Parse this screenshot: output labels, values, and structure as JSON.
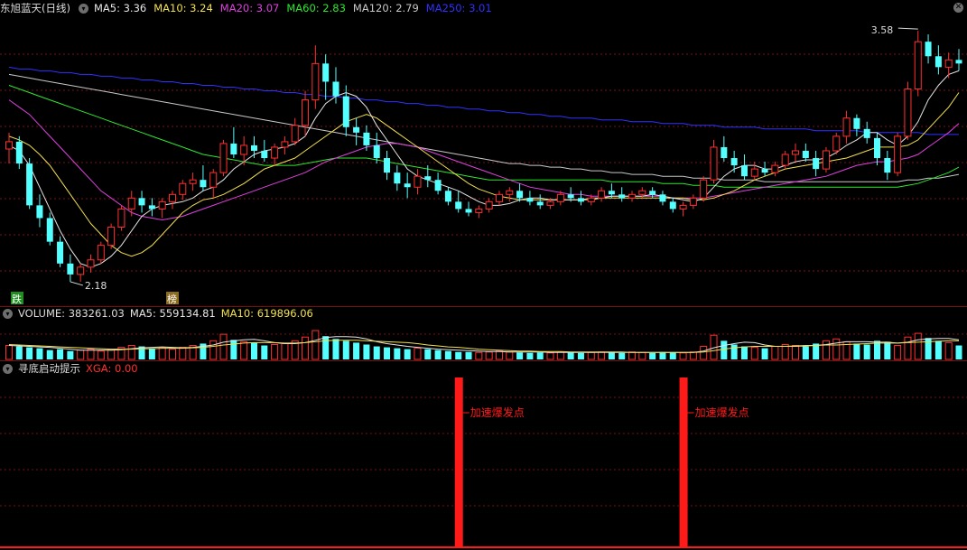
{
  "main_panel": {
    "title": "东旭蓝天",
    "period": "(日线)",
    "ma_values": [
      {
        "label": "MA5:",
        "value": "3.36",
        "color": "#e6e6e6"
      },
      {
        "label": "MA10:",
        "value": "3.24",
        "color": "#f2e14b"
      },
      {
        "label": "MA20:",
        "value": "3.07",
        "color": "#e040e0"
      },
      {
        "label": "MA60:",
        "value": "2.83",
        "color": "#2ee82e"
      },
      {
        "label": "MA120:",
        "value": "2.79",
        "color": "#c8c8c8"
      },
      {
        "label": "MA250:",
        "value": "3.01",
        "color": "#3030ff"
      }
    ],
    "low_marker": "2.18",
    "high_marker": "3.58",
    "tag_die": "跌",
    "tag_bang": "榜"
  },
  "volume_panel": {
    "title": "VOLUME:",
    "value": "383261.03",
    "ma5_label": "MA5:",
    "ma5_value": "559134.81",
    "ma10_label": "MA10:",
    "ma10_value": "619896.06"
  },
  "indicator_panel": {
    "title": "寻底启动提示",
    "xga_label": "XGA:",
    "xga_value": "0.00",
    "signal_label": "加速爆发点"
  },
  "colors": {
    "up": "#ff3030",
    "down": "#54ffff",
    "grid": "#7a1010",
    "signal": "#ff1a1a"
  },
  "chart_data": {
    "type": "candlestick",
    "price_range": [
      2.15,
      3.65
    ],
    "ohlc": [
      [
        2.93,
        3.02,
        2.85,
        2.97
      ],
      [
        2.97,
        3.0,
        2.82,
        2.85
      ],
      [
        2.85,
        2.88,
        2.6,
        2.62
      ],
      [
        2.62,
        2.68,
        2.5,
        2.55
      ],
      [
        2.55,
        2.58,
        2.4,
        2.42
      ],
      [
        2.42,
        2.45,
        2.28,
        2.3
      ],
      [
        2.3,
        2.35,
        2.2,
        2.24
      ],
      [
        2.24,
        2.3,
        2.2,
        2.28
      ],
      [
        2.28,
        2.35,
        2.25,
        2.32
      ],
      [
        2.32,
        2.42,
        2.3,
        2.4
      ],
      [
        2.4,
        2.52,
        2.38,
        2.5
      ],
      [
        2.5,
        2.62,
        2.48,
        2.6
      ],
      [
        2.6,
        2.7,
        2.56,
        2.66
      ],
      [
        2.66,
        2.7,
        2.58,
        2.62
      ],
      [
        2.62,
        2.66,
        2.56,
        2.6
      ],
      [
        2.6,
        2.66,
        2.55,
        2.64
      ],
      [
        2.64,
        2.7,
        2.6,
        2.68
      ],
      [
        2.68,
        2.76,
        2.65,
        2.74
      ],
      [
        2.74,
        2.8,
        2.7,
        2.76
      ],
      [
        2.76,
        2.84,
        2.7,
        2.72
      ],
      [
        2.72,
        2.82,
        2.66,
        2.8
      ],
      [
        2.8,
        2.98,
        2.78,
        2.96
      ],
      [
        2.96,
        3.05,
        2.88,
        2.9
      ],
      [
        2.9,
        3.0,
        2.84,
        2.95
      ],
      [
        2.95,
        3.0,
        2.88,
        2.92
      ],
      [
        2.92,
        2.98,
        2.86,
        2.88
      ],
      [
        2.88,
        2.96,
        2.84,
        2.94
      ],
      [
        2.94,
        3.0,
        2.9,
        2.97
      ],
      [
        2.97,
        3.1,
        2.95,
        3.06
      ],
      [
        3.06,
        3.25,
        3.0,
        3.2
      ],
      [
        3.2,
        3.5,
        3.15,
        3.4
      ],
      [
        3.4,
        3.45,
        3.2,
        3.3
      ],
      [
        3.3,
        3.38,
        3.18,
        3.22
      ],
      [
        3.22,
        3.28,
        3.0,
        3.05
      ],
      [
        3.05,
        3.1,
        2.95,
        3.02
      ],
      [
        3.02,
        3.06,
        2.92,
        2.95
      ],
      [
        2.95,
        3.02,
        2.85,
        2.88
      ],
      [
        2.88,
        2.92,
        2.76,
        2.8
      ],
      [
        2.8,
        2.84,
        2.7,
        2.74
      ],
      [
        2.74,
        2.8,
        2.66,
        2.72
      ],
      [
        2.72,
        2.82,
        2.68,
        2.78
      ],
      [
        2.78,
        2.84,
        2.72,
        2.76
      ],
      [
        2.76,
        2.8,
        2.68,
        2.7
      ],
      [
        2.7,
        2.72,
        2.62,
        2.64
      ],
      [
        2.64,
        2.7,
        2.58,
        2.6
      ],
      [
        2.6,
        2.64,
        2.56,
        2.58
      ],
      [
        2.58,
        2.62,
        2.55,
        2.6
      ],
      [
        2.6,
        2.66,
        2.58,
        2.64
      ],
      [
        2.64,
        2.7,
        2.62,
        2.68
      ],
      [
        2.68,
        2.72,
        2.64,
        2.7
      ],
      [
        2.7,
        2.74,
        2.64,
        2.66
      ],
      [
        2.66,
        2.7,
        2.62,
        2.64
      ],
      [
        2.64,
        2.68,
        2.6,
        2.62
      ],
      [
        2.62,
        2.66,
        2.6,
        2.64
      ],
      [
        2.64,
        2.7,
        2.62,
        2.68
      ],
      [
        2.68,
        2.72,
        2.64,
        2.66
      ],
      [
        2.66,
        2.7,
        2.62,
        2.64
      ],
      [
        2.64,
        2.68,
        2.62,
        2.66
      ],
      [
        2.66,
        2.72,
        2.64,
        2.7
      ],
      [
        2.7,
        2.74,
        2.66,
        2.68
      ],
      [
        2.68,
        2.72,
        2.64,
        2.66
      ],
      [
        2.66,
        2.7,
        2.64,
        2.68
      ],
      [
        2.68,
        2.72,
        2.66,
        2.7
      ],
      [
        2.7,
        2.72,
        2.66,
        2.68
      ],
      [
        2.68,
        2.7,
        2.62,
        2.64
      ],
      [
        2.64,
        2.66,
        2.58,
        2.6
      ],
      [
        2.6,
        2.64,
        2.56,
        2.62
      ],
      [
        2.62,
        2.68,
        2.6,
        2.66
      ],
      [
        2.66,
        2.78,
        2.64,
        2.76
      ],
      [
        2.76,
        2.98,
        2.74,
        2.94
      ],
      [
        2.94,
        3.0,
        2.86,
        2.88
      ],
      [
        2.88,
        2.92,
        2.8,
        2.84
      ],
      [
        2.84,
        2.9,
        2.76,
        2.78
      ],
      [
        2.78,
        2.86,
        2.76,
        2.82
      ],
      [
        2.82,
        2.86,
        2.78,
        2.8
      ],
      [
        2.8,
        2.86,
        2.78,
        2.84
      ],
      [
        2.84,
        2.92,
        2.82,
        2.9
      ],
      [
        2.9,
        2.96,
        2.86,
        2.92
      ],
      [
        2.92,
        2.96,
        2.86,
        2.88
      ],
      [
        2.88,
        2.92,
        2.78,
        2.82
      ],
      [
        2.82,
        2.94,
        2.8,
        2.92
      ],
      [
        2.92,
        3.02,
        2.9,
        3.0
      ],
      [
        3.0,
        3.14,
        2.96,
        3.1
      ],
      [
        3.1,
        3.12,
        3.0,
        3.04
      ],
      [
        3.04,
        3.08,
        2.96,
        2.99
      ],
      [
        2.99,
        3.02,
        2.84,
        2.88
      ],
      [
        2.88,
        2.92,
        2.76,
        2.8
      ],
      [
        2.8,
        3.02,
        2.78,
        3.0
      ],
      [
        3.0,
        3.3,
        2.98,
        3.26
      ],
      [
        3.26,
        3.58,
        3.22,
        3.52
      ],
      [
        3.52,
        3.56,
        3.4,
        3.44
      ],
      [
        3.44,
        3.5,
        3.34,
        3.38
      ],
      [
        3.38,
        3.46,
        3.32,
        3.42
      ],
      [
        3.42,
        3.48,
        3.36,
        3.4
      ]
    ],
    "ma5": [
      2.95,
      2.92,
      2.84,
      2.72,
      2.6,
      2.48,
      2.38,
      2.3,
      2.28,
      2.3,
      2.34,
      2.4,
      2.48,
      2.56,
      2.6,
      2.62,
      2.63,
      2.64,
      2.66,
      2.7,
      2.72,
      2.76,
      2.82,
      2.86,
      2.9,
      2.92,
      2.93,
      2.94,
      2.96,
      3.0,
      3.1,
      3.18,
      3.22,
      3.24,
      3.22,
      3.16,
      3.06,
      2.98,
      2.9,
      2.82,
      2.78,
      2.76,
      2.74,
      2.72,
      2.7,
      2.67,
      2.64,
      2.62,
      2.62,
      2.63,
      2.65,
      2.66,
      2.66,
      2.65,
      2.65,
      2.65,
      2.65,
      2.66,
      2.66,
      2.67,
      2.67,
      2.67,
      2.67,
      2.68,
      2.67,
      2.66,
      2.65,
      2.64,
      2.66,
      2.72,
      2.78,
      2.82,
      2.84,
      2.84,
      2.82,
      2.82,
      2.84,
      2.86,
      2.87,
      2.87,
      2.88,
      2.91,
      2.95,
      2.98,
      3.02,
      3.02,
      2.98,
      2.95,
      3.0,
      3.08,
      3.2,
      3.28,
      3.34,
      3.36
    ],
    "ma10": [
      3.0,
      2.98,
      2.95,
      2.9,
      2.84,
      2.76,
      2.68,
      2.6,
      2.52,
      2.46,
      2.4,
      2.36,
      2.34,
      2.36,
      2.4,
      2.46,
      2.52,
      2.58,
      2.62,
      2.65,
      2.66,
      2.68,
      2.71,
      2.74,
      2.78,
      2.82,
      2.84,
      2.86,
      2.88,
      2.92,
      2.96,
      3.0,
      3.04,
      3.08,
      3.1,
      3.12,
      3.1,
      3.06,
      3.02,
      2.98,
      2.94,
      2.9,
      2.86,
      2.82,
      2.78,
      2.74,
      2.71,
      2.69,
      2.67,
      2.66,
      2.65,
      2.65,
      2.65,
      2.65,
      2.65,
      2.65,
      2.65,
      2.65,
      2.66,
      2.66,
      2.66,
      2.66,
      2.66,
      2.66,
      2.66,
      2.66,
      2.66,
      2.65,
      2.65,
      2.66,
      2.68,
      2.7,
      2.73,
      2.76,
      2.78,
      2.8,
      2.82,
      2.83,
      2.84,
      2.85,
      2.86,
      2.87,
      2.88,
      2.9,
      2.92,
      2.94,
      2.94,
      2.94,
      2.95,
      2.98,
      3.04,
      3.1,
      3.16,
      3.24
    ],
    "ma20": [
      3.2,
      3.16,
      3.12,
      3.06,
      3.0,
      2.94,
      2.88,
      2.82,
      2.76,
      2.7,
      2.66,
      2.62,
      2.58,
      2.56,
      2.55,
      2.54,
      2.55,
      2.56,
      2.58,
      2.6,
      2.62,
      2.64,
      2.66,
      2.68,
      2.7,
      2.72,
      2.74,
      2.76,
      2.78,
      2.8,
      2.83,
      2.86,
      2.88,
      2.9,
      2.92,
      2.94,
      2.95,
      2.96,
      2.96,
      2.95,
      2.94,
      2.92,
      2.9,
      2.88,
      2.86,
      2.84,
      2.82,
      2.8,
      2.78,
      2.76,
      2.74,
      2.72,
      2.71,
      2.7,
      2.69,
      2.68,
      2.68,
      2.67,
      2.67,
      2.67,
      2.67,
      2.67,
      2.67,
      2.67,
      2.67,
      2.66,
      2.66,
      2.66,
      2.66,
      2.67,
      2.68,
      2.69,
      2.7,
      2.71,
      2.72,
      2.73,
      2.74,
      2.75,
      2.76,
      2.77,
      2.78,
      2.8,
      2.82,
      2.84,
      2.85,
      2.86,
      2.86,
      2.87,
      2.88,
      2.9,
      2.94,
      2.98,
      3.02,
      3.07
    ],
    "ma60": [
      3.28,
      3.26,
      3.24,
      3.22,
      3.2,
      3.18,
      3.16,
      3.14,
      3.12,
      3.1,
      3.08,
      3.06,
      3.04,
      3.02,
      3.0,
      2.98,
      2.96,
      2.94,
      2.92,
      2.9,
      2.89,
      2.88,
      2.87,
      2.86,
      2.85,
      2.84,
      2.84,
      2.84,
      2.84,
      2.85,
      2.86,
      2.87,
      2.88,
      2.88,
      2.88,
      2.88,
      2.87,
      2.86,
      2.85,
      2.84,
      2.83,
      2.82,
      2.81,
      2.8,
      2.79,
      2.78,
      2.77,
      2.76,
      2.76,
      2.76,
      2.76,
      2.76,
      2.76,
      2.76,
      2.76,
      2.76,
      2.76,
      2.76,
      2.76,
      2.75,
      2.75,
      2.75,
      2.75,
      2.75,
      2.74,
      2.74,
      2.74,
      2.73,
      2.73,
      2.73,
      2.72,
      2.72,
      2.72,
      2.72,
      2.72,
      2.72,
      2.72,
      2.72,
      2.72,
      2.72,
      2.72,
      2.72,
      2.72,
      2.72,
      2.72,
      2.72,
      2.72,
      2.72,
      2.73,
      2.74,
      2.76,
      2.78,
      2.8,
      2.83
    ],
    "ma120": [
      3.34,
      3.33,
      3.32,
      3.31,
      3.3,
      3.29,
      3.28,
      3.27,
      3.26,
      3.25,
      3.24,
      3.23,
      3.22,
      3.21,
      3.2,
      3.19,
      3.18,
      3.17,
      3.16,
      3.15,
      3.14,
      3.13,
      3.12,
      3.11,
      3.1,
      3.09,
      3.08,
      3.07,
      3.06,
      3.05,
      3.04,
      3.03,
      3.02,
      3.01,
      3.0,
      2.99,
      2.98,
      2.97,
      2.96,
      2.95,
      2.94,
      2.93,
      2.92,
      2.91,
      2.9,
      2.89,
      2.88,
      2.87,
      2.86,
      2.85,
      2.85,
      2.84,
      2.84,
      2.83,
      2.83,
      2.82,
      2.82,
      2.81,
      2.81,
      2.8,
      2.8,
      2.79,
      2.79,
      2.79,
      2.78,
      2.78,
      2.78,
      2.77,
      2.77,
      2.77,
      2.76,
      2.76,
      2.76,
      2.76,
      2.75,
      2.75,
      2.75,
      2.75,
      2.75,
      2.75,
      2.75,
      2.75,
      2.75,
      2.75,
      2.75,
      2.75,
      2.75,
      2.75,
      2.76,
      2.76,
      2.77,
      2.77,
      2.78,
      2.79
    ],
    "ma250": [
      3.38,
      3.37,
      3.37,
      3.36,
      3.36,
      3.35,
      3.35,
      3.34,
      3.34,
      3.33,
      3.33,
      3.32,
      3.32,
      3.31,
      3.31,
      3.3,
      3.3,
      3.29,
      3.29,
      3.28,
      3.28,
      3.27,
      3.27,
      3.26,
      3.26,
      3.25,
      3.25,
      3.24,
      3.24,
      3.23,
      3.23,
      3.22,
      3.22,
      3.21,
      3.21,
      3.2,
      3.2,
      3.19,
      3.19,
      3.18,
      3.18,
      3.17,
      3.17,
      3.16,
      3.16,
      3.15,
      3.15,
      3.14,
      3.14,
      3.13,
      3.13,
      3.12,
      3.12,
      3.11,
      3.11,
      3.1,
      3.1,
      3.1,
      3.09,
      3.09,
      3.09,
      3.08,
      3.08,
      3.08,
      3.07,
      3.07,
      3.07,
      3.06,
      3.06,
      3.06,
      3.05,
      3.05,
      3.05,
      3.05,
      3.04,
      3.04,
      3.04,
      3.04,
      3.04,
      3.03,
      3.03,
      3.03,
      3.03,
      3.03,
      3.02,
      3.02,
      3.02,
      3.02,
      3.02,
      3.02,
      3.01,
      3.01,
      3.01,
      3.01
    ],
    "volume": [
      30,
      28,
      26,
      24,
      20,
      22,
      18,
      20,
      22,
      18,
      20,
      26,
      30,
      28,
      24,
      26,
      22,
      26,
      30,
      34,
      40,
      54,
      42,
      38,
      36,
      30,
      32,
      34,
      40,
      48,
      62,
      50,
      44,
      40,
      36,
      32,
      28,
      26,
      24,
      22,
      24,
      22,
      20,
      18,
      16,
      16,
      15,
      16,
      18,
      16,
      15,
      14,
      15,
      14,
      16,
      15,
      14,
      15,
      16,
      15,
      14,
      16,
      15,
      14,
      16,
      15,
      14,
      16,
      28,
      52,
      40,
      32,
      28,
      26,
      24,
      28,
      32,
      30,
      28,
      34,
      40,
      44,
      38,
      34,
      32,
      40,
      38,
      30,
      48,
      56,
      46,
      40,
      36,
      30
    ],
    "vol_ma5": [
      30,
      29,
      28,
      27,
      26,
      24,
      22,
      20,
      20,
      20,
      20,
      21,
      23,
      25,
      26,
      27,
      26,
      25,
      26,
      28,
      31,
      37,
      40,
      42,
      43,
      40,
      36,
      34,
      34,
      36,
      41,
      47,
      49,
      49,
      48,
      44,
      38,
      34,
      31,
      28,
      26,
      24,
      22,
      21,
      20,
      19,
      18,
      17,
      17,
      16,
      16,
      16,
      16,
      15,
      15,
      15,
      15,
      15,
      15,
      15,
      15,
      15,
      15,
      15,
      15,
      15,
      15,
      15,
      18,
      25,
      30,
      34,
      37,
      36,
      31,
      28,
      28,
      28,
      29,
      30,
      32,
      35,
      38,
      38,
      38,
      37,
      37,
      35,
      37,
      42,
      44,
      45,
      45,
      42
    ],
    "vol_ma10": [
      32,
      31,
      30,
      29,
      28,
      27,
      26,
      25,
      24,
      23,
      22,
      22,
      22,
      23,
      23,
      24,
      24,
      24,
      25,
      26,
      28,
      31,
      33,
      35,
      36,
      36,
      36,
      35,
      35,
      36,
      38,
      40,
      41,
      41,
      41,
      40,
      39,
      38,
      37,
      36,
      34,
      31,
      29,
      27,
      26,
      24,
      22,
      21,
      20,
      19,
      18,
      18,
      17,
      17,
      17,
      16,
      16,
      16,
      16,
      16,
      16,
      15,
      15,
      15,
      15,
      15,
      15,
      15,
      16,
      19,
      22,
      25,
      27,
      28,
      28,
      28,
      28,
      29,
      30,
      30,
      31,
      31,
      32,
      33,
      34,
      35,
      35,
      35,
      36,
      37,
      38,
      39,
      40,
      40
    ],
    "signal_index": [
      44,
      66
    ]
  }
}
